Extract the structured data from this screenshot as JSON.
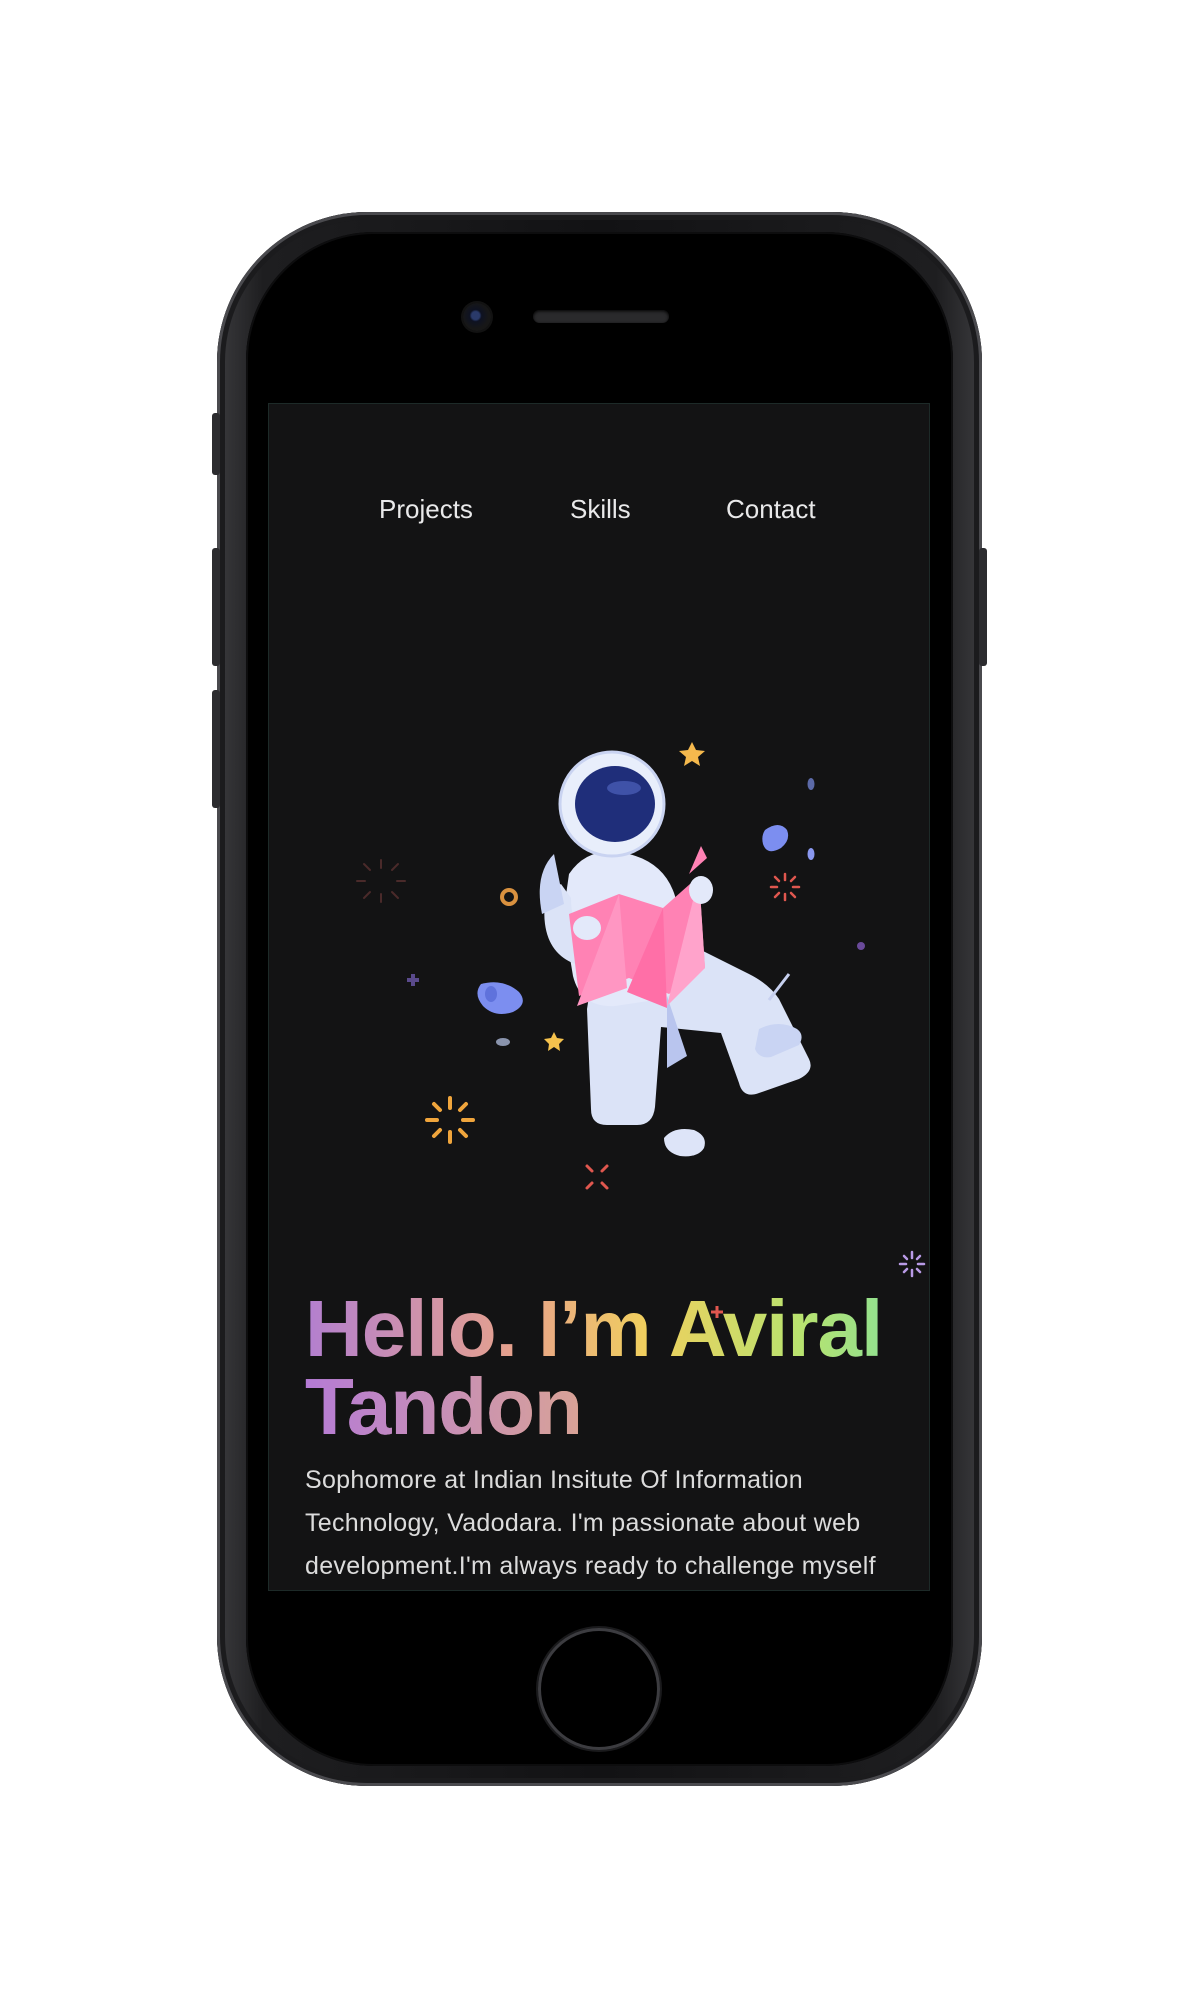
{
  "nav": {
    "items": [
      {
        "label": "Projects"
      },
      {
        "label": "Skills"
      },
      {
        "label": "Contact"
      }
    ]
  },
  "hero": {
    "title_line1": "Hello. I’m Aviral",
    "title_line2": "Tandon",
    "bio": "Sophomore at Indian Insitute Of Information Technology, Vadodara. I'm passionate about web development.I'm always ready to challenge myself and explore new areas of"
  },
  "illustration": {
    "icon": "astronaut-reading-map-illustration"
  },
  "colors": {
    "screen_bg": "#131314",
    "text": "#e9e9ea",
    "gradient_start": "#b37fd0",
    "gradient_mid": "#f0cf5e",
    "gradient_end": "#7fe0a0"
  }
}
